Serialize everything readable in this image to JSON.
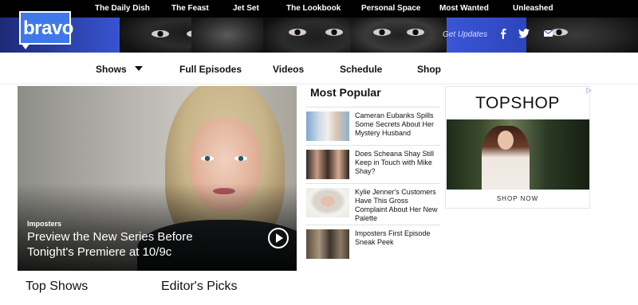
{
  "top_nav": {
    "items": [
      "The Daily Dish",
      "The Feast",
      "Jet Set",
      "The Lookbook",
      "Personal Space",
      "Most Wanted",
      "Unleashed"
    ]
  },
  "header": {
    "logo_text": "bravo",
    "get_updates": "Get Updates",
    "social_icons": [
      "facebook-icon",
      "twitter-icon",
      "email-icon"
    ],
    "banner_color": "#2c43b8"
  },
  "main_nav": {
    "items": [
      "Shows",
      "Full Episodes",
      "Videos",
      "Schedule",
      "Shop"
    ],
    "shows_has_dropdown": true
  },
  "feature": {
    "kicker": "Imposters",
    "title": "Preview the New Series Before Tonight's Premiere at 10/9c",
    "icon": "play-icon"
  },
  "most_popular": {
    "title": "Most Popular",
    "items": [
      {
        "headline": "Cameran Eubanks Spills Some Secrets About Her Mystery Husband"
      },
      {
        "headline": "Does Scheana Shay Still Keep in Touch with Mike Shay?"
      },
      {
        "headline": "Kylie Jenner's Customers Have This Gross Complaint About Her New Palette"
      },
      {
        "headline": "Imposters First Episode Sneak Peek"
      }
    ]
  },
  "ad": {
    "brand": "TOPSHOP",
    "cta": "SHOP NOW",
    "adchoices_mark": "▷"
  },
  "sections": {
    "top_shows": "Top Shows",
    "editors_picks": "Editor's Picks"
  }
}
